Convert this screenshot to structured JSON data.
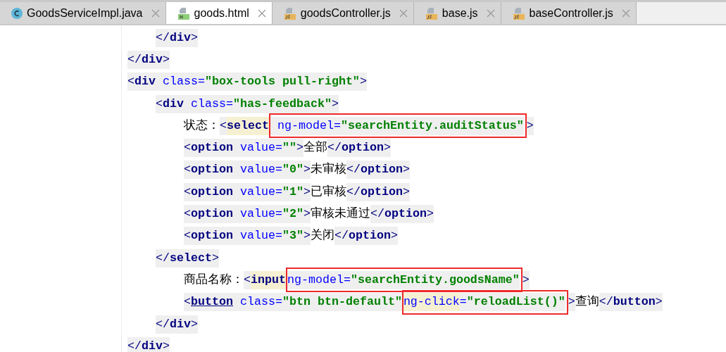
{
  "tabs": [
    {
      "label": "GoodsServiceImpl.java",
      "kind": "java",
      "selected": false
    },
    {
      "label": "goods.html",
      "kind": "html",
      "selected": true
    },
    {
      "label": "goodsController.js",
      "kind": "js",
      "selected": false
    },
    {
      "label": "base.js",
      "kind": "js",
      "selected": false
    },
    {
      "label": "baseController.js",
      "kind": "js",
      "selected": false
    }
  ],
  "code_lines": [
    {
      "children": [
        {
          "parts": [
            {
              "boxed": false,
              "tokens": [
                {
                  "kind": "punct",
                  "text": "</",
                  "shaded": true,
                  "marked": false
                },
                {
                  "kind": "tag",
                  "text": "div",
                  "shaded": true,
                  "marked": false
                },
                {
                  "kind": "punct",
                  "text": ">",
                  "shaded": true,
                  "marked": false
                }
              ]
            }
          ]
        }
      ]
    },
    {
      "parts": [
        {
          "boxed": false,
          "tokens": [
            {
              "kind": "punct",
              "text": "</",
              "shaded": true,
              "marked": false
            },
            {
              "kind": "tag",
              "text": "div",
              "shaded": true,
              "marked": false
            },
            {
              "kind": "punct",
              "text": ">",
              "shaded": true,
              "marked": false
            }
          ]
        }
      ]
    },
    {
      "parts": [
        {
          "boxed": false,
          "tokens": [
            {
              "kind": "punct",
              "text": "<",
              "shaded": true,
              "marked": false
            },
            {
              "kind": "tag",
              "text": "div",
              "shaded": true,
              "marked": false
            },
            {
              "kind": "attr",
              "text": " class=",
              "shaded": true,
              "marked": false
            },
            {
              "kind": "value",
              "text": "\"box-tools pull-right\"",
              "shaded": true,
              "marked": false
            },
            {
              "kind": "punct",
              "text": ">",
              "shaded": true,
              "marked": false
            }
          ]
        }
      ],
      "children": [
        {
          "parts": [
            {
              "boxed": false,
              "tokens": [
                {
                  "kind": "punct",
                  "text": "<",
                  "shaded": true,
                  "marked": false
                },
                {
                  "kind": "tag",
                  "text": "div",
                  "shaded": true,
                  "marked": false
                },
                {
                  "kind": "attr",
                  "text": " class=",
                  "shaded": true,
                  "marked": false
                },
                {
                  "kind": "value",
                  "text": "\"has-feedback\"",
                  "shaded": true,
                  "marked": false
                },
                {
                  "kind": "punct",
                  "text": ">",
                  "shaded": true,
                  "marked": false
                }
              ]
            }
          ],
          "children": [
            {
              "parts": [
                {
                  "boxed": false,
                  "tokens": [
                    {
                      "kind": "text",
                      "text": "状态：",
                      "shaded": false,
                      "marked": false
                    },
                    {
                      "kind": "punct",
                      "text": "<",
                      "shaded": true,
                      "marked": false
                    },
                    {
                      "kind": "tag",
                      "text": "select",
                      "shaded": false,
                      "marked": true
                    }
                  ]
                },
                {
                  "boxed": true,
                  "tokens": [
                    {
                      "kind": "attr",
                      "text": " ng-model=",
                      "shaded": true,
                      "marked": false
                    },
                    {
                      "kind": "value",
                      "text": "\"searchEntity.auditStatus\"",
                      "shaded": true,
                      "marked": false
                    }
                  ]
                },
                {
                  "boxed": false,
                  "tokens": [
                    {
                      "kind": "punct",
                      "text": ">",
                      "shaded": true,
                      "marked": false
                    }
                  ]
                }
              ]
            },
            {
              "parts": [
                {
                  "boxed": false,
                  "tokens": [
                    {
                      "kind": "punct",
                      "text": "<",
                      "shaded": true,
                      "marked": false
                    },
                    {
                      "kind": "tag",
                      "text": "option",
                      "shaded": true,
                      "marked": false
                    },
                    {
                      "kind": "attr",
                      "text": " value=",
                      "shaded": true,
                      "marked": false
                    },
                    {
                      "kind": "value",
                      "text": "\"\"",
                      "shaded": true,
                      "marked": false
                    },
                    {
                      "kind": "punct",
                      "text": ">",
                      "shaded": true,
                      "marked": false
                    },
                    {
                      "kind": "text",
                      "text": "全部",
                      "shaded": false,
                      "marked": false
                    },
                    {
                      "kind": "punct",
                      "text": "</",
                      "shaded": true,
                      "marked": false
                    },
                    {
                      "kind": "tag",
                      "text": "option",
                      "shaded": true,
                      "marked": false
                    },
                    {
                      "kind": "punct",
                      "text": ">",
                      "shaded": true,
                      "marked": false
                    }
                  ]
                }
              ]
            },
            {
              "parts": [
                {
                  "boxed": false,
                  "tokens": [
                    {
                      "kind": "punct",
                      "text": "<",
                      "shaded": true,
                      "marked": false
                    },
                    {
                      "kind": "tag",
                      "text": "option",
                      "shaded": true,
                      "marked": false
                    },
                    {
                      "kind": "attr",
                      "text": " value=",
                      "shaded": true,
                      "marked": false
                    },
                    {
                      "kind": "value",
                      "text": "\"0\"",
                      "shaded": true,
                      "marked": false
                    },
                    {
                      "kind": "punct",
                      "text": ">",
                      "shaded": true,
                      "marked": false
                    },
                    {
                      "kind": "text",
                      "text": "未审核",
                      "shaded": false,
                      "marked": false
                    },
                    {
                      "kind": "punct",
                      "text": "</",
                      "shaded": true,
                      "marked": false
                    },
                    {
                      "kind": "tag",
                      "text": "option",
                      "shaded": true,
                      "marked": false
                    },
                    {
                      "kind": "punct",
                      "text": ">",
                      "shaded": true,
                      "marked": false
                    }
                  ]
                }
              ]
            },
            {
              "parts": [
                {
                  "boxed": false,
                  "tokens": [
                    {
                      "kind": "punct",
                      "text": "<",
                      "shaded": true,
                      "marked": false
                    },
                    {
                      "kind": "tag",
                      "text": "option",
                      "shaded": true,
                      "marked": false
                    },
                    {
                      "kind": "attr",
                      "text": " value=",
                      "shaded": true,
                      "marked": false
                    },
                    {
                      "kind": "value",
                      "text": "\"1\"",
                      "shaded": true,
                      "marked": false
                    },
                    {
                      "kind": "punct",
                      "text": ">",
                      "shaded": true,
                      "marked": false
                    },
                    {
                      "kind": "text",
                      "text": "已审核",
                      "shaded": false,
                      "marked": false
                    },
                    {
                      "kind": "punct",
                      "text": "</",
                      "shaded": true,
                      "marked": false
                    },
                    {
                      "kind": "tag",
                      "text": "option",
                      "shaded": true,
                      "marked": false
                    },
                    {
                      "kind": "punct",
                      "text": ">",
                      "shaded": true,
                      "marked": false
                    }
                  ]
                }
              ]
            },
            {
              "parts": [
                {
                  "boxed": false,
                  "tokens": [
                    {
                      "kind": "punct",
                      "text": "<",
                      "shaded": true,
                      "marked": false
                    },
                    {
                      "kind": "tag",
                      "text": "option",
                      "shaded": true,
                      "marked": false
                    },
                    {
                      "kind": "attr",
                      "text": " value=",
                      "shaded": true,
                      "marked": false
                    },
                    {
                      "kind": "value",
                      "text": "\"2\"",
                      "shaded": true,
                      "marked": false
                    },
                    {
                      "kind": "punct",
                      "text": ">",
                      "shaded": true,
                      "marked": false
                    },
                    {
                      "kind": "text",
                      "text": "审核未通过",
                      "shaded": false,
                      "marked": false
                    },
                    {
                      "kind": "punct",
                      "text": "</",
                      "shaded": true,
                      "marked": false
                    },
                    {
                      "kind": "tag",
                      "text": "option",
                      "shaded": true,
                      "marked": false
                    },
                    {
                      "kind": "punct",
                      "text": ">",
                      "shaded": true,
                      "marked": false
                    }
                  ]
                }
              ]
            },
            {
              "parts": [
                {
                  "boxed": false,
                  "tokens": [
                    {
                      "kind": "punct",
                      "text": "<",
                      "shaded": true,
                      "marked": false
                    },
                    {
                      "kind": "tag",
                      "text": "option",
                      "shaded": true,
                      "marked": false
                    },
                    {
                      "kind": "attr",
                      "text": " value=",
                      "shaded": true,
                      "marked": false
                    },
                    {
                      "kind": "value",
                      "text": "\"3\"",
                      "shaded": true,
                      "marked": false
                    },
                    {
                      "kind": "punct",
                      "text": ">",
                      "shaded": true,
                      "marked": false
                    },
                    {
                      "kind": "text",
                      "text": "关闭",
                      "shaded": false,
                      "marked": false
                    },
                    {
                      "kind": "punct",
                      "text": "</",
                      "shaded": true,
                      "marked": false
                    },
                    {
                      "kind": "tag",
                      "text": "option",
                      "shaded": true,
                      "marked": false
                    },
                    {
                      "kind": "punct",
                      "text": ">",
                      "shaded": true,
                      "marked": false
                    }
                  ]
                }
              ]
            }
          ]
        },
        {
          "parts": [
            {
              "boxed": false,
              "tokens": [
                {
                  "kind": "punct",
                  "text": "</",
                  "shaded": true,
                  "marked": false
                },
                {
                  "kind": "tag",
                  "text": "select",
                  "shaded": true,
                  "marked": false
                },
                {
                  "kind": "punct",
                  "text": ">",
                  "shaded": true,
                  "marked": false
                }
              ]
            }
          ],
          "children": [
            {
              "parts": [
                {
                  "boxed": false,
                  "tokens": [
                    {
                      "kind": "text",
                      "text": "商品名称：",
                      "shaded": false,
                      "marked": false
                    },
                    {
                      "kind": "punct",
                      "text": "<",
                      "shaded": true,
                      "marked": false
                    },
                    {
                      "kind": "tag",
                      "text": "input",
                      "shaded": false,
                      "marked": true
                    }
                  ]
                },
                {
                  "boxed": true,
                  "tokens": [
                    {
                      "kind": "attr",
                      "text": "ng-model=",
                      "shaded": true,
                      "marked": false
                    },
                    {
                      "kind": "value",
                      "text": "\"searchEntity.goodsName\"",
                      "shaded": true,
                      "marked": false
                    }
                  ]
                },
                {
                  "boxed": false,
                  "tokens": [
                    {
                      "kind": "punct",
                      "text": ">",
                      "shaded": true,
                      "marked": false
                    }
                  ]
                }
              ]
            },
            {
              "parts": [
                {
                  "boxed": false,
                  "tokens": [
                    {
                      "kind": "punct",
                      "text": "<",
                      "shaded": true,
                      "marked": false
                    },
                    {
                      "kind": "tag-underlined",
                      "text": "button",
                      "shaded": true,
                      "marked": false
                    },
                    {
                      "kind": "attr",
                      "text": " class=",
                      "shaded": true,
                      "marked": false
                    },
                    {
                      "kind": "value",
                      "text": "\"btn btn-default\"",
                      "shaded": true,
                      "marked": false
                    }
                  ]
                },
                {
                  "boxed": true,
                  "tokens": [
                    {
                      "kind": "attr",
                      "text": "ng-click",
                      "shaded": false,
                      "marked": true
                    },
                    {
                      "kind": "attr",
                      "text": "=",
                      "shaded": true,
                      "marked": false
                    },
                    {
                      "kind": "value",
                      "text": "\"reloadList()\"",
                      "shaded": true,
                      "marked": false
                    }
                  ]
                },
                {
                  "boxed": false,
                  "tokens": [
                    {
                      "kind": "punct",
                      "text": ">",
                      "shaded": true,
                      "marked": false
                    },
                    {
                      "kind": "text",
                      "text": "查询",
                      "shaded": false,
                      "marked": false
                    },
                    {
                      "kind": "punct",
                      "text": "</",
                      "shaded": true,
                      "marked": false
                    },
                    {
                      "kind": "tag",
                      "text": "button",
                      "shaded": true,
                      "marked": false
                    },
                    {
                      "kind": "punct",
                      "text": ">",
                      "shaded": true,
                      "marked": false
                    }
                  ]
                }
              ]
            }
          ]
        },
        {
          "parts": [
            {
              "boxed": false,
              "tokens": [
                {
                  "kind": "punct",
                  "text": "</",
                  "shaded": true,
                  "marked": false
                },
                {
                  "kind": "tag",
                  "text": "div",
                  "shaded": true,
                  "marked": false
                },
                {
                  "kind": "punct",
                  "text": ">",
                  "shaded": true,
                  "marked": false
                }
              ]
            }
          ]
        }
      ]
    },
    {
      "parts": [
        {
          "boxed": false,
          "tokens": [
            {
              "kind": "punct",
              "text": "</",
              "shaded": true,
              "marked": false
            },
            {
              "kind": "tag",
              "text": "div",
              "shaded": true,
              "marked": false
            },
            {
              "kind": "punct",
              "text": ">",
              "shaded": true,
              "marked": false
            }
          ]
        }
      ]
    }
  ]
}
